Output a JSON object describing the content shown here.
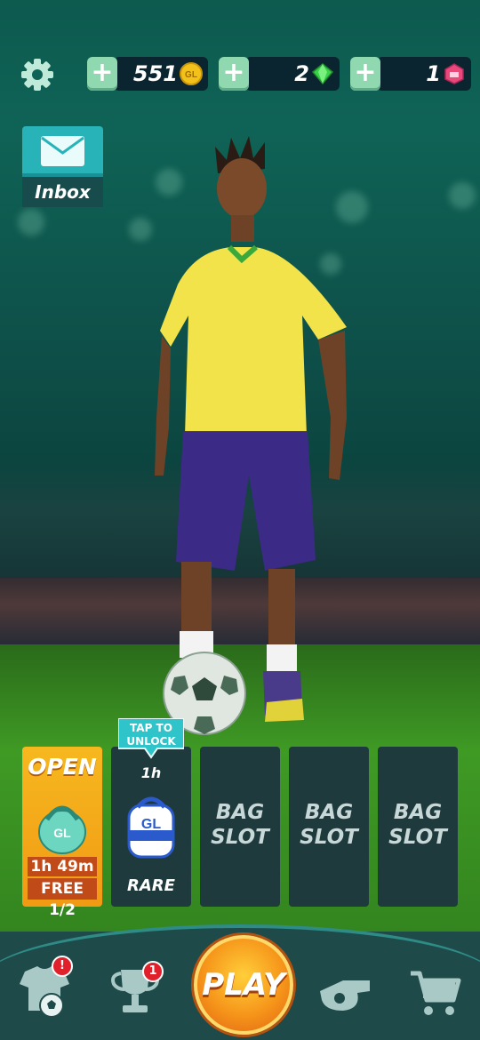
{
  "currencies": [
    {
      "value": "551",
      "icon": "gold-coin-icon",
      "color": "#f3c21a"
    },
    {
      "value": "2",
      "icon": "green-gem-icon",
      "color": "#3ad24a"
    },
    {
      "value": "1",
      "icon": "pink-ticket-icon",
      "color": "#e8487a"
    }
  ],
  "inbox": {
    "label": "Inbox"
  },
  "bag_slots": [
    {
      "state": "open",
      "title": "OPEN",
      "timer": "1h 49m",
      "free": "FREE 1/2"
    },
    {
      "state": "locked",
      "tag": "TAP TO UNLOCK",
      "time": "1h",
      "rarity": "RARE"
    },
    {
      "state": "empty",
      "label": "BAG SLOT"
    },
    {
      "state": "empty",
      "label": "BAG SLOT"
    },
    {
      "state": "empty",
      "label": "BAG SLOT"
    }
  ],
  "nav": {
    "play_label": "PLAY",
    "trophy_badge": "1",
    "kit_badge": "!"
  },
  "colors": {
    "accent": "#27b3b7",
    "play": "#f6951a",
    "nav": "#1f4a4a"
  }
}
